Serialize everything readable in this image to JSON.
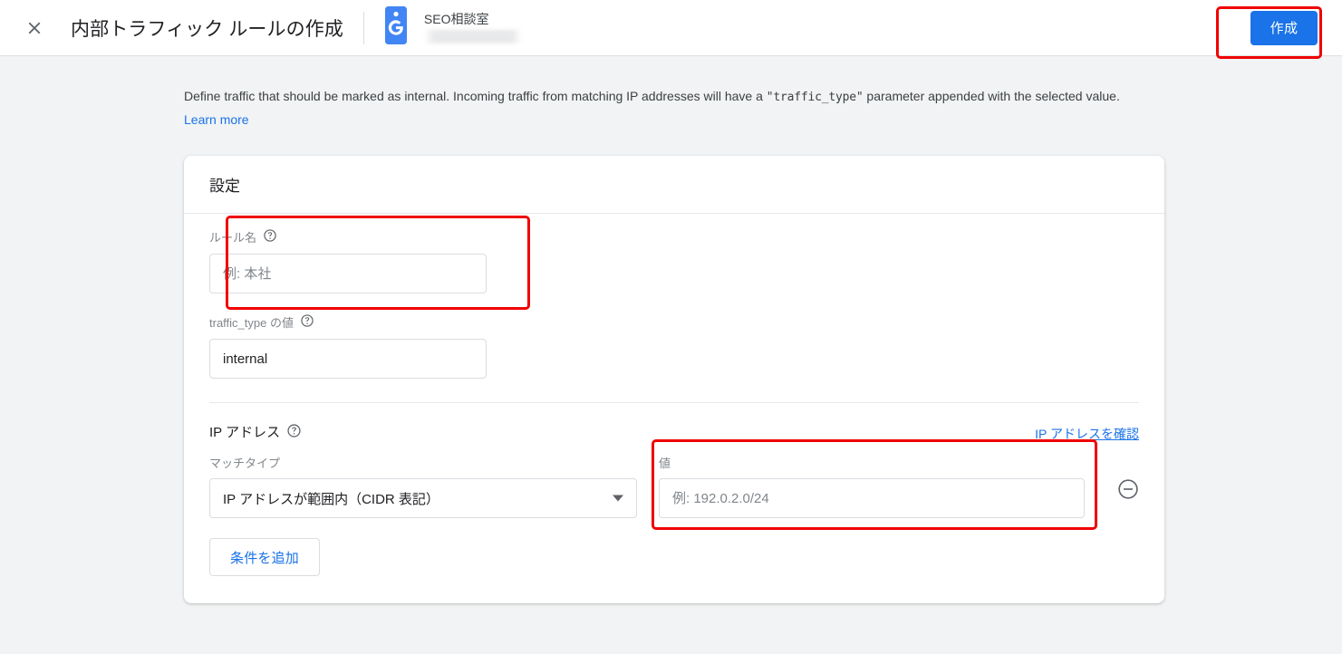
{
  "header": {
    "close_icon": "close-icon",
    "title": "内部トラフィック ルールの作成",
    "account": {
      "logo_icon": "google-tag-icon",
      "name": "SEO相談室",
      "property_redacted": ""
    },
    "create_label": "作成"
  },
  "description": {
    "part1": "Define traffic that should be marked as internal. Incoming traffic from matching IP addresses will have a ",
    "code": "\"traffic_type\"",
    "part2": " parameter appended with the selected value. ",
    "learn_more": "Learn more"
  },
  "card": {
    "title": "設定",
    "rule_name": {
      "label": "ルール名",
      "help_icon": "help-circle-icon",
      "placeholder": "例: 本社",
      "value": ""
    },
    "traffic_type": {
      "label": "traffic_type の値",
      "help_icon": "help-circle-icon",
      "placeholder": "internal",
      "value": "internal"
    },
    "ip_section": {
      "label": "IP アドレス",
      "help_icon": "help-circle-icon",
      "check_ip_link": "IP アドレスを確認",
      "match_type": {
        "label": "マッチタイプ",
        "selected": "IP アドレスが範囲内（CIDR 表記）",
        "caret_icon": "chevron-down-icon"
      },
      "value_field": {
        "label": "値",
        "placeholder": "例: 192.0.2.0/24",
        "value": ""
      },
      "remove_icon": "minus-circle-icon",
      "add_condition_label": "条件を追加"
    }
  },
  "colors": {
    "accent_blue": "#1a73e8",
    "annotation_red": "#f00000",
    "page_background": "#f1f3f4",
    "card_background": "#ffffff",
    "label_grey": "#80868b",
    "border_grey": "#dadce0"
  }
}
